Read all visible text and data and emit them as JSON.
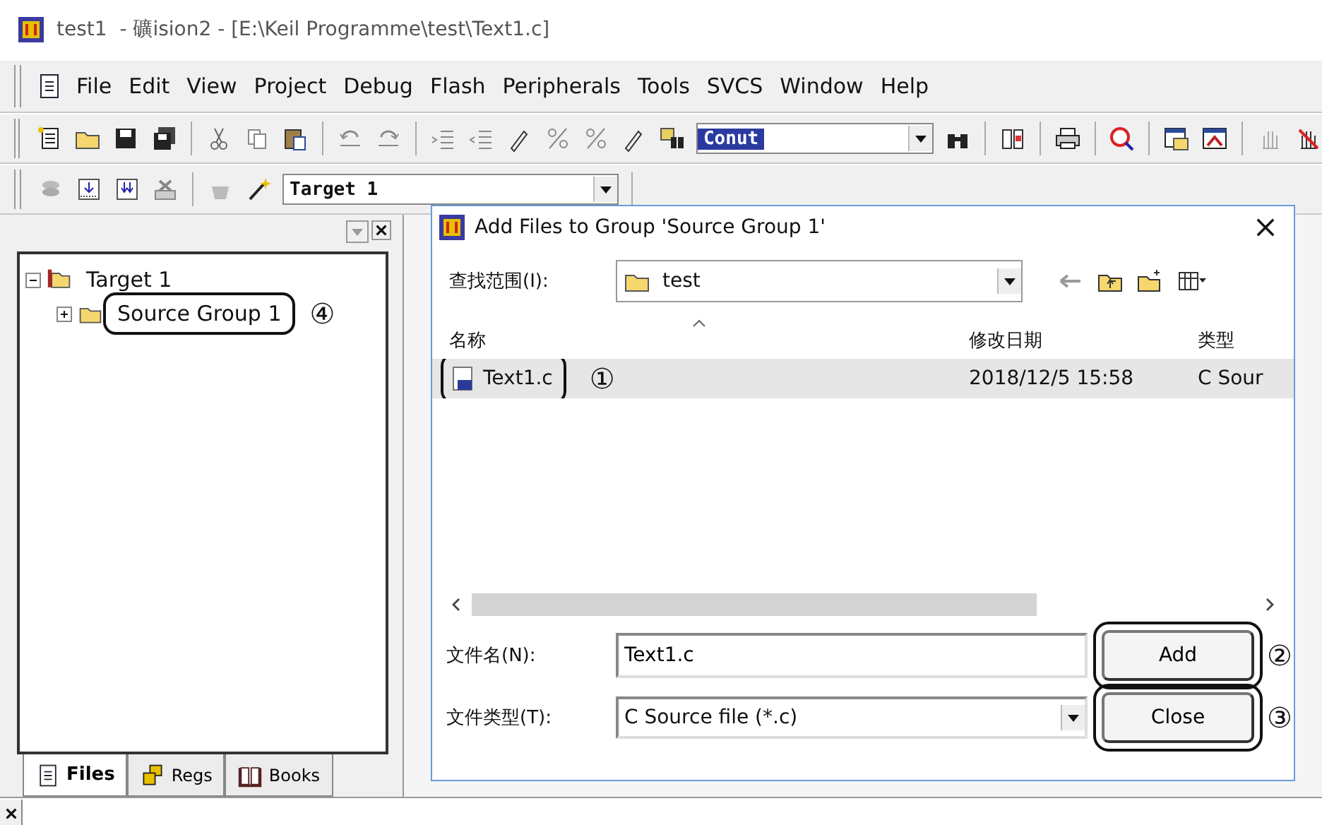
{
  "window": {
    "title": "test1  - 礦ision2 - [E:\\Keil Programme\\test\\Text1.c]"
  },
  "menu": [
    "File",
    "Edit",
    "View",
    "Project",
    "Debug",
    "Flash",
    "Peripherals",
    "Tools",
    "SVCS",
    "Window",
    "Help"
  ],
  "toolbar": {
    "find_text": "Conut"
  },
  "build_toolbar": {
    "target": "Target 1"
  },
  "project_panel": {
    "tree": [
      {
        "label": "Target 1",
        "expanded": true,
        "annotated": false,
        "children": [
          {
            "label": "Source Group 1",
            "expanded": false,
            "annotated": true,
            "callout": "④"
          }
        ]
      }
    ],
    "tabs": [
      {
        "label": "Files",
        "selected": true
      },
      {
        "label": "Regs",
        "selected": false
      },
      {
        "label": "Books",
        "selected": false
      }
    ]
  },
  "dialog": {
    "title": "Add Files to Group 'Source Group 1'",
    "look_in_label": "查找范围(I):",
    "look_in": "test",
    "columns": [
      "名称",
      "修改日期",
      "类型"
    ],
    "files": [
      {
        "name": "Text1.c",
        "modified": "2018/12/5 15:58",
        "type": "C Sour",
        "selected": true,
        "annotated": true,
        "callout": "①"
      }
    ],
    "file_name_label": "文件名(N):",
    "file_name": "Text1.c",
    "file_type_label": "文件类型(T):",
    "file_type": "C Source file (*.c)",
    "buttons": [
      {
        "label": "Add",
        "annotated": true,
        "callout": "②"
      },
      {
        "label": "Close",
        "annotated": true,
        "callout": "③"
      }
    ]
  }
}
